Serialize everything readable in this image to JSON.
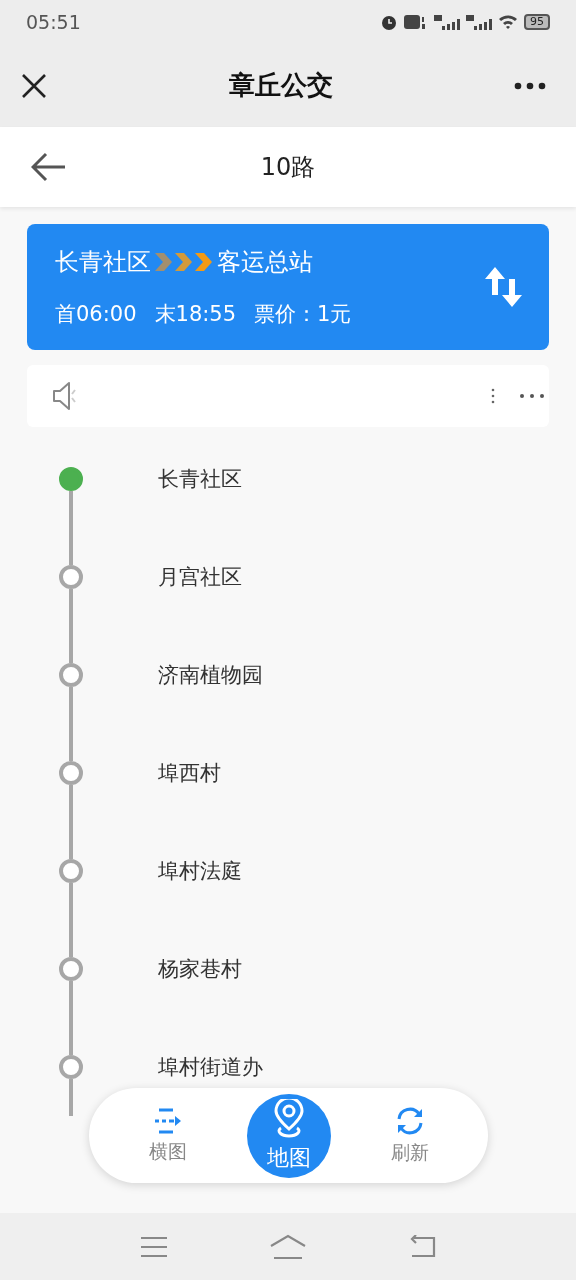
{
  "status_bar": {
    "time": "05:51",
    "battery": "95"
  },
  "header": {
    "title": "章丘公交"
  },
  "subheader": {
    "title": "10路"
  },
  "route_card": {
    "from": "长青社区",
    "to": "客运总站",
    "first": "首06:00",
    "last": "末18:55",
    "fare": "票价：1元"
  },
  "stops": [
    {
      "name": "长青社区",
      "current": true
    },
    {
      "name": "月宫社区",
      "current": false
    },
    {
      "name": "济南植物园",
      "current": false
    },
    {
      "name": "埠西村",
      "current": false
    },
    {
      "name": "埠村法庭",
      "current": false
    },
    {
      "name": "杨家巷村",
      "current": false
    },
    {
      "name": "埠村街道办",
      "current": false
    }
  ],
  "bottom_tabs": [
    {
      "label": "横图",
      "kind": "horizontal",
      "selected": false
    },
    {
      "label": "地图",
      "kind": "map",
      "selected": true
    },
    {
      "label": "刷新",
      "kind": "refresh",
      "selected": false
    }
  ]
}
